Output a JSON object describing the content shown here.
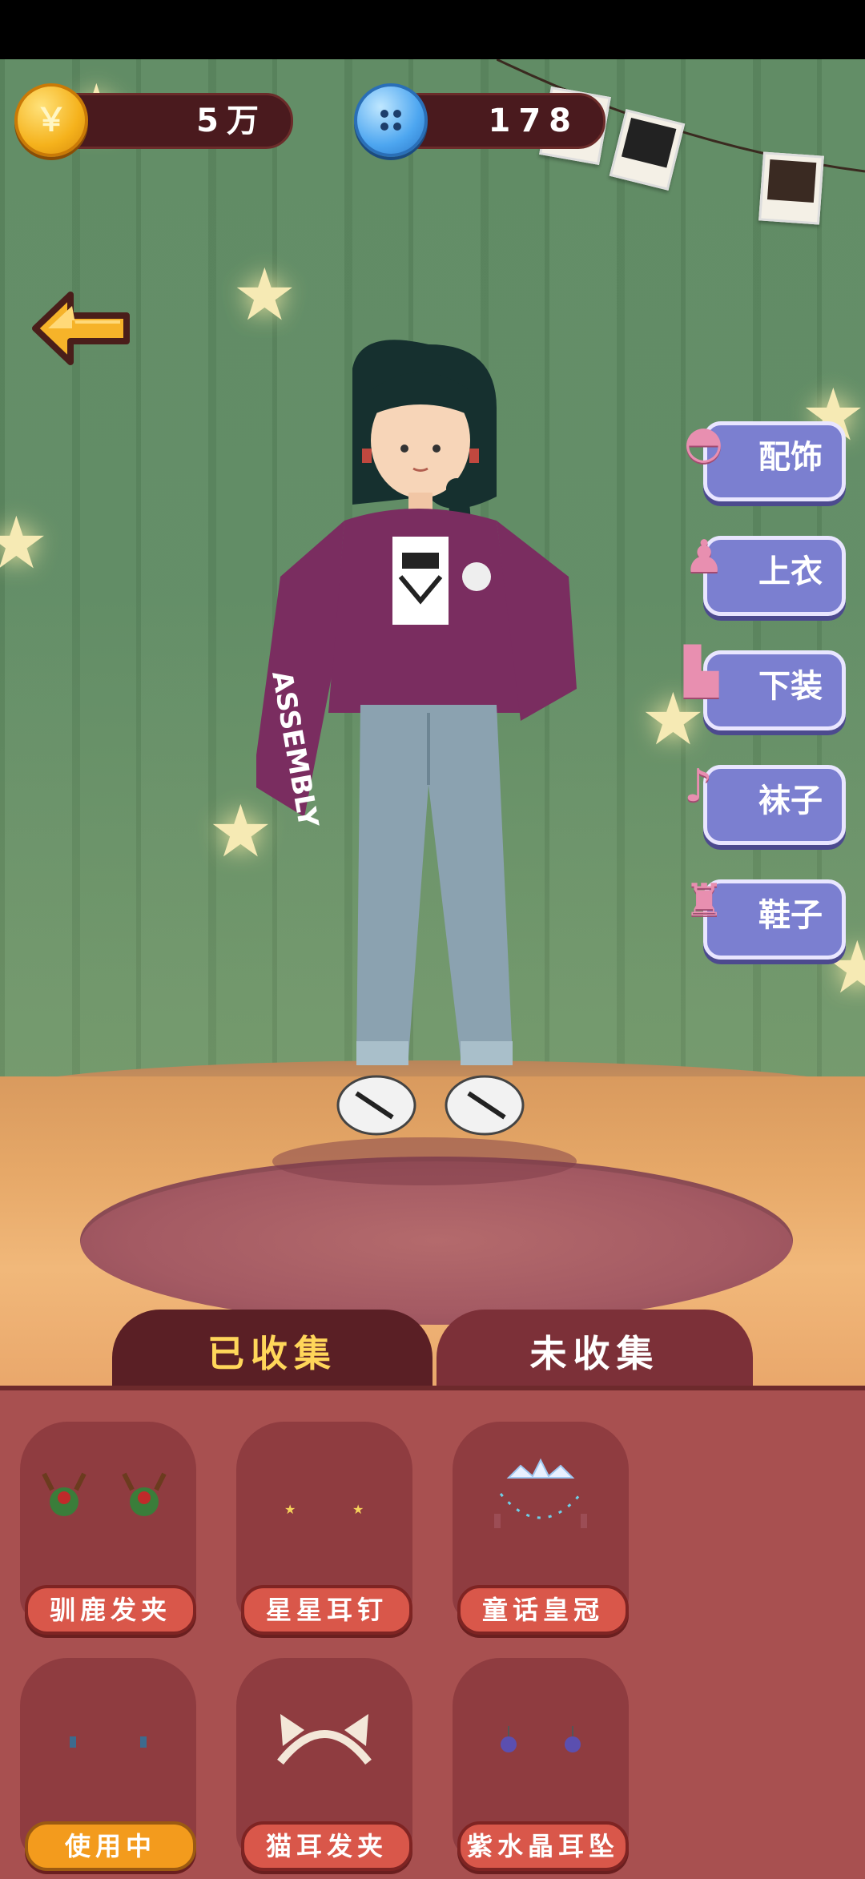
{
  "currency": {
    "coins": "5万",
    "coin_symbol": "￥",
    "buttons": "178"
  },
  "categories": [
    {
      "label": "配饰",
      "icon": "hat-icon"
    },
    {
      "label": "上衣",
      "icon": "shirt-icon"
    },
    {
      "label": "下装",
      "icon": "pants-icon"
    },
    {
      "label": "袜子",
      "icon": "sock-icon"
    },
    {
      "label": "鞋子",
      "icon": "shoe-icon"
    }
  ],
  "tabs": {
    "collected": "已收集",
    "uncollected": "未收集"
  },
  "items": [
    {
      "name": "驯鹿发夹",
      "state": "normal",
      "icon": "reindeer-clip-icon"
    },
    {
      "name": "星星耳钉",
      "state": "normal",
      "icon": "star-earring-icon"
    },
    {
      "name": "童话皇冠",
      "state": "normal",
      "icon": "crown-icon"
    },
    {
      "name": "使用中",
      "state": "in-use",
      "icon": "small-earring-icon"
    },
    {
      "name": "猫耳发夹",
      "state": "normal",
      "icon": "cat-ear-clip-icon"
    },
    {
      "name": "紫水晶耳坠",
      "state": "normal",
      "icon": "amethyst-earring-icon"
    }
  ],
  "colors": {
    "panel": "#a85050",
    "tab_active_text": "#ffd65a",
    "category_plate": "#7b7fd0",
    "item_button": "#d9574a",
    "in_use_button": "#f39b1d"
  }
}
